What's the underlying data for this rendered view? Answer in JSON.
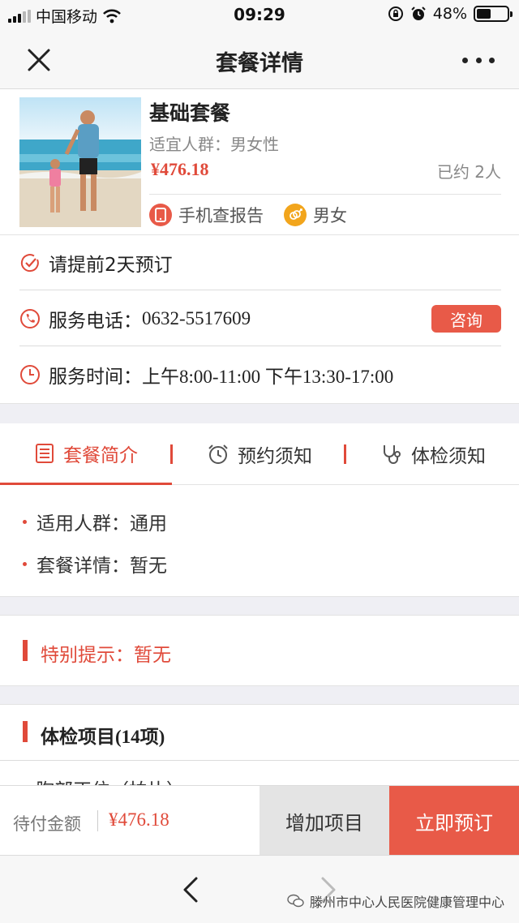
{
  "status_bar": {
    "carrier": "中国移动",
    "time": "09:29",
    "battery": "48%",
    "battery_level": 0.48
  },
  "nav": {
    "title": "套餐详情",
    "close_icon": "close-icon",
    "more_icon": "more-icon"
  },
  "package": {
    "title": "基础套餐",
    "crowd": "适宜人群：男女性",
    "price": "¥476.18",
    "booked": "已约 2人",
    "tags": [
      {
        "label": "手机查报告",
        "icon": "phone-icon",
        "color": "#e85a48"
      },
      {
        "label": "男女",
        "icon": "gender-icon",
        "color": "#f2a51c"
      }
    ]
  },
  "info": {
    "advance": "请提前2天预订",
    "phone_label": "服务电话：",
    "phone": "0632-5517609",
    "consult_label": "咨询",
    "hours_label": "服务时间：",
    "hours": "上午8:00-11:00 下午13:30-17:00"
  },
  "tabs": [
    {
      "label": "套餐简介",
      "icon": "list-icon",
      "active": true
    },
    {
      "label": "预约须知",
      "icon": "alarm-clock-icon",
      "active": false
    },
    {
      "label": "体检须知",
      "icon": "stethoscope-icon",
      "active": false
    }
  ],
  "intro": {
    "crowd_label": "适用人群：",
    "crowd_value": "通用",
    "detail_label": "套餐详情：",
    "detail_value": "暂无"
  },
  "tip": {
    "label": "特别提示：",
    "value": "暂无"
  },
  "items": {
    "title": "体检项目(14项)",
    "first_item": "胸部正位（拍片）"
  },
  "bottom_bar": {
    "pay_label": "待付金额",
    "pay_amount": "¥476.18",
    "add_label": "增加项目",
    "book_label": "立即预订"
  },
  "toolbar": {
    "watermark": "滕州市中心人民医院健康管理中心"
  },
  "colors": {
    "accent": "#e04a3a",
    "button_red": "#e85a48",
    "tag_orange": "#f2a51c"
  }
}
